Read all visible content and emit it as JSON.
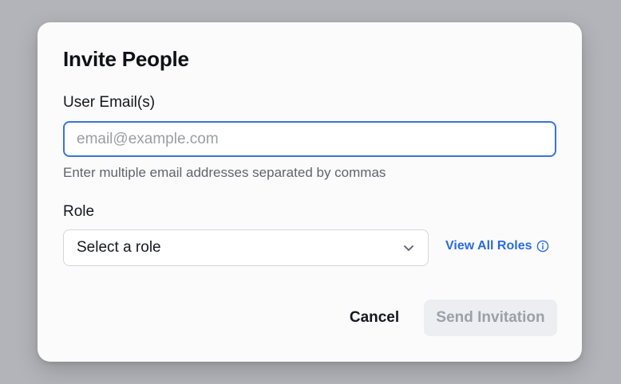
{
  "dialog": {
    "title": "Invite People"
  },
  "email_field": {
    "label": "User Email(s)",
    "value": "",
    "placeholder": "email@example.com",
    "helper_text": "Enter multiple email addresses separated by commas",
    "focus_color": "#3a73d9"
  },
  "role_field": {
    "label": "Role",
    "selected": "Select a role",
    "icon": "chevron-down-icon"
  },
  "view_roles_link": {
    "label": "View All Roles",
    "icon": "info-icon",
    "color": "#2a6be0"
  },
  "actions": {
    "cancel_label": "Cancel",
    "send_label": "Send Invitation",
    "send_disabled": true
  }
}
